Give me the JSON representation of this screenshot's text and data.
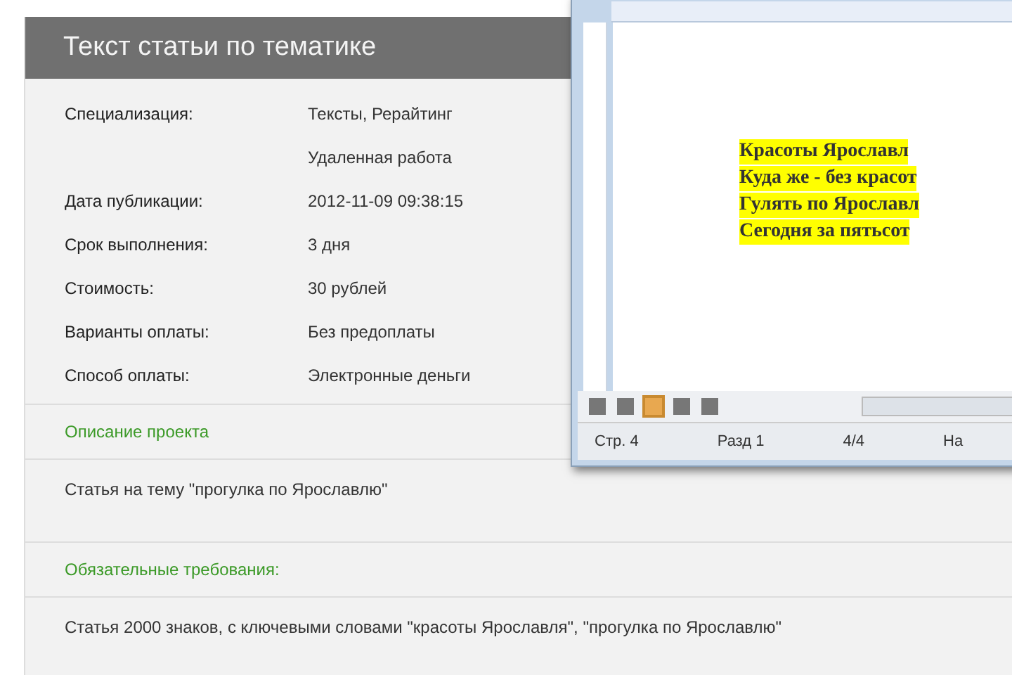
{
  "panel": {
    "title": "Текст статьи по тематике",
    "fields": [
      {
        "label": "Специализация:",
        "values": [
          "Тексты, Рерайтинг",
          "Удаленная работа"
        ]
      },
      {
        "label": "Дата публикации:",
        "values": [
          "2012-11-09 09:38:15"
        ]
      },
      {
        "label": "Срок выполнения:",
        "values": [
          "3 дня"
        ]
      },
      {
        "label": "Стоимость:",
        "values": [
          "30 рублей"
        ]
      },
      {
        "label": "Варианты оплаты:",
        "values": [
          "Без предоплаты"
        ]
      },
      {
        "label": "Способ оплаты:",
        "values": [
          "Электронные деньги"
        ]
      }
    ],
    "sections": [
      {
        "heading": "Описание проекта",
        "text": "Статья на тему \"прогулка по Ярославлю\""
      },
      {
        "heading": "Обязательные требования:",
        "text": "Статья 2000 знаков, с ключевыми словами \"красоты Ярославля\", \"прогулка по Ярославлю\""
      }
    ]
  },
  "editor": {
    "lines": [
      "Красоты Ярославл",
      "Куда же - без красот",
      "Гулять по Ярославл",
      "Сегодня за пятьсот"
    ],
    "status_bar": [
      "Стр. 4",
      "Разд 1",
      "4/4",
      "На"
    ]
  }
}
